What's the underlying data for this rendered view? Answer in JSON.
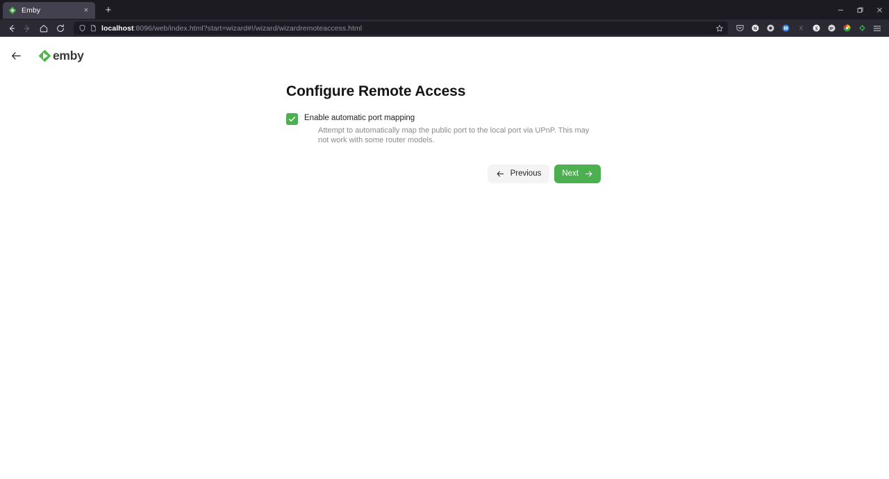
{
  "browser": {
    "tab": {
      "title": "Emby",
      "favicon_icon": "emby-diamond-icon",
      "close_icon": "close-icon",
      "close_glyph": "×"
    },
    "new_tab_label": "+",
    "new_tab_icon": "plus-icon",
    "window_controls": {
      "minimize_icon": "minimize-icon",
      "restore_icon": "restore-icon",
      "close_icon": "window-close-icon"
    },
    "nav": {
      "back_icon": "back-arrow-icon",
      "forward_icon": "forward-arrow-icon",
      "home_icon": "home-icon",
      "reload_icon": "reload-icon"
    },
    "url": {
      "shield_icon": "shield-icon",
      "page_icon": "page-document-icon",
      "host": "localhost",
      "path": ":8096/web/index.html?start=wizard#!/wizard/wizardremoteaccess.html",
      "full": "localhost:8096/web/index.html?start=wizard#!/wizard/wizardremoteaccess.html",
      "bookmark_icon": "star-bookmark-icon"
    },
    "extensions": [
      {
        "name": "pocket-icon",
        "glyph": "◑"
      },
      {
        "name": "extension-n-icon",
        "glyph": "N"
      },
      {
        "name": "extension-circle-icon",
        "glyph": "●"
      },
      {
        "name": "extension-m-icon",
        "glyph": "M"
      },
      {
        "name": "extension-x-icon",
        "glyph": "X"
      },
      {
        "name": "extension-s-icon",
        "glyph": "S"
      },
      {
        "name": "extension-ip-icon",
        "glyph": "IP"
      },
      {
        "name": "extension-colorful-icon",
        "glyph": "◔"
      },
      {
        "name": "extension-green-icon",
        "glyph": "◆"
      },
      {
        "name": "app-menu-icon",
        "glyph": "☰"
      }
    ]
  },
  "page": {
    "back_icon": "page-back-arrow-icon",
    "logo": {
      "mark_icon": "emby-logo-mark-icon",
      "text": "emby"
    },
    "wizard": {
      "title": "Configure Remote Access",
      "checkbox": {
        "checked": true,
        "check_icon": "checkmark-icon",
        "label": "Enable automatic port mapping",
        "description": "Attempt to automatically map the public port to the local port via UPnP. This may not work with some router models."
      },
      "buttons": {
        "previous": {
          "label": "Previous",
          "icon": "arrow-left-icon"
        },
        "next": {
          "label": "Next",
          "icon": "arrow-right-icon"
        }
      }
    }
  },
  "colors": {
    "emby_green": "#4caf50",
    "chrome_dark": "#1c1b22",
    "toolbar_dark": "#2b2a33",
    "tab_active": "#42414d",
    "button_neutral": "#f4f4f5",
    "text_primary": "#141414",
    "text_muted": "#8a8a8a"
  }
}
